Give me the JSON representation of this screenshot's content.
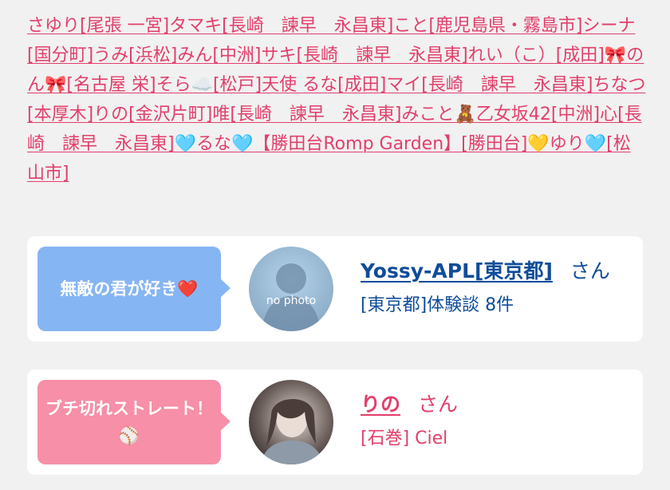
{
  "links": [
    "さゆり[尾張 一宮]",
    "タマキ[長崎　諫早　永昌東]",
    "こと[鹿児島県・霧島市]",
    "シーナ[国分町]",
    "うみ[浜松]",
    "みん[中洲]",
    "サキ[長崎　諫早　永昌東]",
    "れい（こ）[成田]",
    "🎀のん🎀[名古屋 栄]",
    "そら☁️[松戸]",
    "天使 るな[成田]",
    "マイ[長崎　諫早　永昌東]",
    "ちなつ[本厚木]",
    "りの[金沢片町]",
    "唯[長崎　諫早　永昌東]",
    "みこと🧸乙女坂42[中洲]",
    "心[長崎　諫早　永昌東]",
    "🩵るな🩵【勝田台Romp Garden】[勝田台]",
    "💛ゆり🩵[松山市]"
  ],
  "cards": [
    {
      "bubble": "無敵の君が好き❤️",
      "avatar_text": "no photo",
      "name": "Yossy-APL[東京都]",
      "suffix": "さん",
      "sub": "[東京都]体験談 8件"
    },
    {
      "bubble": "ブチ切れストレート！⚾",
      "name": "りの",
      "suffix": "さん",
      "sub": "[石巻] Ciel"
    }
  ]
}
